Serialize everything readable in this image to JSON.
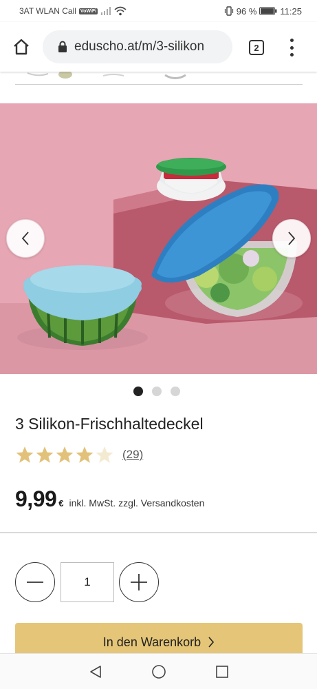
{
  "status_bar": {
    "carrier": "3AT WLAN Call",
    "volte_badge": "VoWiFi",
    "battery": "96 %",
    "time": "11:25"
  },
  "browser": {
    "url": "eduscho.at/m/3-silikon",
    "tab_count": "2"
  },
  "product": {
    "title": "3 Silikon-Frischhaltedeckel",
    "rating": 4,
    "rating_max": 5,
    "review_count": "(29)",
    "price": "9,99",
    "currency": "€",
    "tax_note": "inkl. MwSt. zzgl. Versandkosten"
  },
  "carousel": {
    "slide_count": 3,
    "active_slide": 1
  },
  "quantity": {
    "value": "1"
  },
  "cart": {
    "label": "In den Warenkorb"
  },
  "colors": {
    "accent_button": "#e5c678",
    "star_fill": "#e2c27a",
    "hero_background": "#e4a2b0"
  },
  "icons": [
    "home-icon",
    "lock-icon",
    "tabs-icon",
    "more-vert-icon",
    "chevron-left-icon",
    "chevron-right-icon",
    "minus-icon",
    "plus-icon",
    "star-icon",
    "back-nav-icon",
    "home-nav-icon",
    "recents-nav-icon"
  ]
}
